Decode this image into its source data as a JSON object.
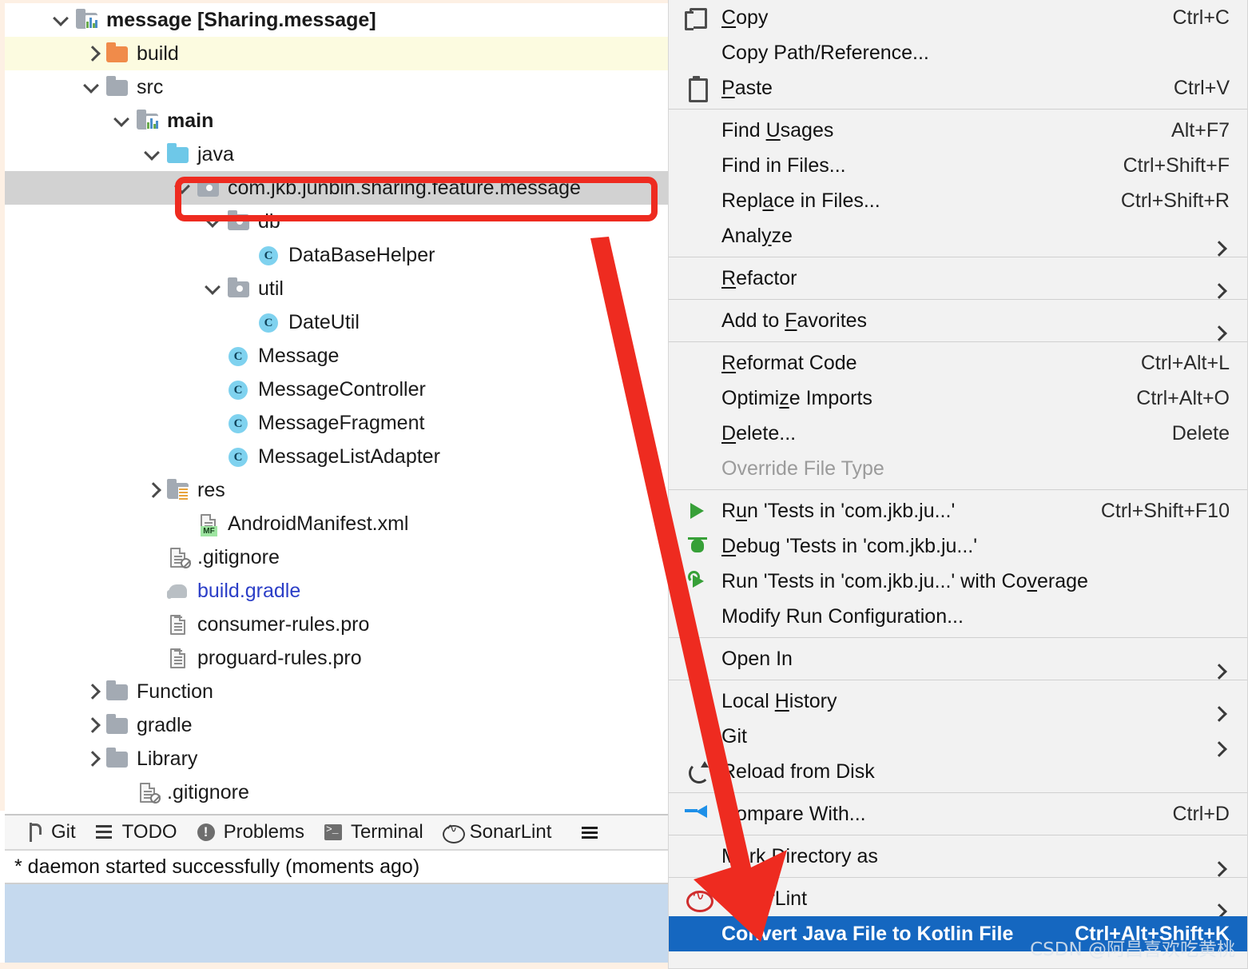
{
  "project_tree": {
    "rows": [
      {
        "label": "message [Sharing.message]",
        "icon": "module-icon",
        "arrow": "down",
        "indent": 0,
        "style": "bold",
        "highlight": "none"
      },
      {
        "label": "build",
        "icon": "folder-orange-icon",
        "arrow": "right",
        "indent": 1,
        "style": "normal",
        "highlight": "yellow"
      },
      {
        "label": "src",
        "icon": "folder-grey-icon",
        "arrow": "down",
        "indent": 1,
        "style": "normal",
        "highlight": "none"
      },
      {
        "label": "main",
        "icon": "module-icon",
        "arrow": "down",
        "indent": 2,
        "style": "bold",
        "highlight": "none"
      },
      {
        "label": "java",
        "icon": "folder-cyan-icon",
        "arrow": "down",
        "indent": 3,
        "style": "normal",
        "highlight": "none"
      },
      {
        "label": "com.jkb.junbin.sharing.feature.message",
        "icon": "package-icon",
        "arrow": "down",
        "indent": 4,
        "style": "normal",
        "highlight": "grey"
      },
      {
        "label": "db",
        "icon": "package-icon",
        "arrow": "down",
        "indent": 5,
        "style": "normal",
        "highlight": "none"
      },
      {
        "label": "DataBaseHelper",
        "icon": "class-icon",
        "arrow": "none",
        "indent": 6,
        "style": "normal",
        "highlight": "none"
      },
      {
        "label": "util",
        "icon": "package-icon",
        "arrow": "down",
        "indent": 5,
        "style": "normal",
        "highlight": "none"
      },
      {
        "label": "DateUtil",
        "icon": "class-icon",
        "arrow": "none",
        "indent": 6,
        "style": "normal",
        "highlight": "none"
      },
      {
        "label": "Message",
        "icon": "class-icon",
        "arrow": "none",
        "indent": 5,
        "style": "normal",
        "highlight": "none"
      },
      {
        "label": "MessageController",
        "icon": "class-icon",
        "arrow": "none",
        "indent": 5,
        "style": "normal",
        "highlight": "none"
      },
      {
        "label": "MessageFragment",
        "icon": "class-icon",
        "arrow": "none",
        "indent": 5,
        "style": "normal",
        "highlight": "none"
      },
      {
        "label": "MessageListAdapter",
        "icon": "class-icon",
        "arrow": "none",
        "indent": 5,
        "style": "normal",
        "highlight": "none"
      },
      {
        "label": "res",
        "icon": "res-folder-icon",
        "arrow": "right",
        "indent": 3,
        "style": "normal",
        "highlight": "none"
      },
      {
        "label": "AndroidManifest.xml",
        "icon": "manifest-file-icon",
        "arrow": "none",
        "indent": 4,
        "style": "normal",
        "highlight": "none"
      },
      {
        "label": ".gitignore",
        "icon": "gitignore-file-icon",
        "arrow": "none",
        "indent": 3,
        "style": "normal",
        "highlight": "none"
      },
      {
        "label": "build.gradle",
        "icon": "gradle-file-icon",
        "arrow": "none",
        "indent": 3,
        "style": "link",
        "highlight": "none"
      },
      {
        "label": "consumer-rules.pro",
        "icon": "text-file-icon",
        "arrow": "none",
        "indent": 3,
        "style": "normal",
        "highlight": "none"
      },
      {
        "label": "proguard-rules.pro",
        "icon": "text-file-icon",
        "arrow": "none",
        "indent": 3,
        "style": "normal",
        "highlight": "none"
      },
      {
        "label": "Function",
        "icon": "folder-grey-icon",
        "arrow": "right",
        "indent": 1,
        "style": "normal",
        "highlight": "none"
      },
      {
        "label": "gradle",
        "icon": "folder-grey-icon",
        "arrow": "right",
        "indent": 1,
        "style": "normal",
        "highlight": "none"
      },
      {
        "label": "Library",
        "icon": "folder-grey-icon",
        "arrow": "right",
        "indent": 1,
        "style": "normal",
        "highlight": "none"
      },
      {
        "label": ".gitignore",
        "icon": "gitignore-file-icon",
        "arrow": "none",
        "indent": 2,
        "style": "normal",
        "highlight": "none"
      }
    ]
  },
  "tool_window_bar": {
    "items": [
      {
        "label": "Git",
        "icon": "git-icon"
      },
      {
        "label": "TODO",
        "icon": "todo-icon"
      },
      {
        "label": "Problems",
        "icon": "problems-icon"
      },
      {
        "label": "Terminal",
        "icon": "terminal-icon"
      },
      {
        "label": "SonarLint",
        "icon": "sonarlint-icon"
      }
    ],
    "more_icon": "more-hamburger-icon"
  },
  "console": {
    "message": "* daemon started successfully (moments ago)"
  },
  "context_menu": {
    "items": [
      {
        "kind": "item",
        "label": "Copy",
        "mnemonic": "C",
        "shortcut": "Ctrl+C",
        "icon": "copy-icon"
      },
      {
        "kind": "item",
        "label": "Copy Path/Reference...",
        "mnemonic": "",
        "shortcut": "",
        "icon": ""
      },
      {
        "kind": "item",
        "label": "Paste",
        "mnemonic": "P",
        "shortcut": "Ctrl+V",
        "icon": "paste-icon"
      },
      {
        "kind": "separator"
      },
      {
        "kind": "item",
        "label": "Find Usages",
        "mnemonic": "U",
        "shortcut": "Alt+F7",
        "icon": ""
      },
      {
        "kind": "item",
        "label": "Find in Files...",
        "mnemonic": "",
        "shortcut": "Ctrl+Shift+F",
        "icon": ""
      },
      {
        "kind": "item",
        "label": "Replace in Files...",
        "mnemonic": "a",
        "shortcut": "Ctrl+Shift+R",
        "icon": ""
      },
      {
        "kind": "item",
        "label": "Analyze",
        "mnemonic": "y",
        "shortcut": "",
        "icon": "",
        "submenu": true
      },
      {
        "kind": "separator"
      },
      {
        "kind": "item",
        "label": "Refactor",
        "mnemonic": "R",
        "shortcut": "",
        "icon": "",
        "submenu": true
      },
      {
        "kind": "separator"
      },
      {
        "kind": "item",
        "label": "Add to Favorites",
        "mnemonic": "F",
        "shortcut": "",
        "icon": "",
        "submenu": true
      },
      {
        "kind": "separator"
      },
      {
        "kind": "item",
        "label": "Reformat Code",
        "mnemonic": "R",
        "shortcut": "Ctrl+Alt+L",
        "icon": ""
      },
      {
        "kind": "item",
        "label": "Optimize Imports",
        "mnemonic": "z",
        "shortcut": "Ctrl+Alt+O",
        "icon": ""
      },
      {
        "kind": "item",
        "label": "Delete...",
        "mnemonic": "D",
        "shortcut": "Delete",
        "icon": ""
      },
      {
        "kind": "item",
        "label": "Override File Type",
        "mnemonic": "",
        "shortcut": "",
        "icon": "",
        "disabled": true
      },
      {
        "kind": "separator"
      },
      {
        "kind": "item",
        "label": "Run 'Tests in 'com.jkb.ju...'",
        "mnemonic": "u",
        "shortcut": "Ctrl+Shift+F10",
        "icon": "run-icon"
      },
      {
        "kind": "item",
        "label": "Debug 'Tests in 'com.jkb.ju...'",
        "mnemonic": "D",
        "shortcut": "",
        "icon": "debug-icon"
      },
      {
        "kind": "item",
        "label": "Run 'Tests in 'com.jkb.ju...' with Coverage",
        "mnemonic": "v",
        "shortcut": "",
        "icon": "run-coverage-icon"
      },
      {
        "kind": "item",
        "label": "Modify Run Configuration...",
        "mnemonic": "",
        "shortcut": "",
        "icon": ""
      },
      {
        "kind": "separator"
      },
      {
        "kind": "item",
        "label": "Open In",
        "mnemonic": "",
        "shortcut": "",
        "icon": "",
        "submenu": true
      },
      {
        "kind": "separator"
      },
      {
        "kind": "item",
        "label": "Local History",
        "mnemonic": "H",
        "shortcut": "",
        "icon": "",
        "submenu": true
      },
      {
        "kind": "item",
        "label": "Git",
        "mnemonic": "",
        "shortcut": "",
        "icon": "",
        "submenu": true
      },
      {
        "kind": "item",
        "label": "Reload from Disk",
        "mnemonic": "",
        "shortcut": "",
        "icon": "reload-icon"
      },
      {
        "kind": "separator"
      },
      {
        "kind": "item",
        "label": "Compare With...",
        "mnemonic": "",
        "shortcut": "Ctrl+D",
        "icon": "compare-icon"
      },
      {
        "kind": "separator"
      },
      {
        "kind": "item",
        "label": "Mark Directory as",
        "mnemonic": "",
        "shortcut": "",
        "icon": "",
        "submenu": true
      },
      {
        "kind": "separator"
      },
      {
        "kind": "item",
        "label": "SonarLint",
        "mnemonic": "",
        "shortcut": "",
        "icon": "sonarlint-menu-icon",
        "submenu": true
      },
      {
        "kind": "item",
        "label": "Convert Java File to Kotlin File",
        "mnemonic": "",
        "shortcut": "Ctrl+Alt+Shift+K",
        "icon": "",
        "selected": true
      }
    ]
  },
  "annotation": {
    "arrow_color": "#ee2b20",
    "callout_box_color": "#ee2b20"
  },
  "watermark": {
    "text": "CSDN @阿昌喜欢吃黄桃"
  },
  "colors": {
    "selection_blue": "#1567c0",
    "tree_selection_grey": "#d2d2d2",
    "build_highlight_yellow": "#fcfbe0",
    "menu_background": "#f2f2f2",
    "console_band_blue": "#c5d9ee"
  }
}
